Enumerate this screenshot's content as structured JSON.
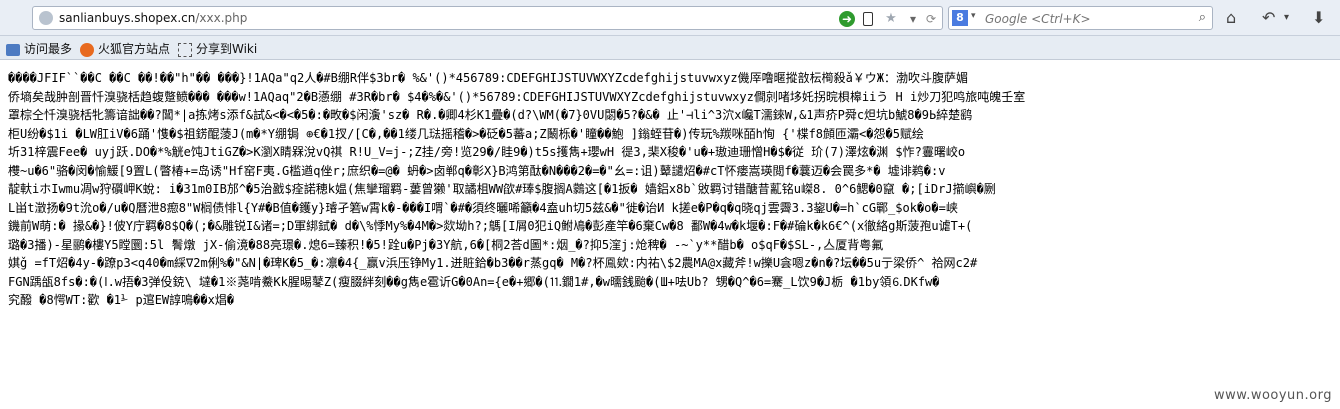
{
  "browser": {
    "url": {
      "domain": "sanlianbuys.shopex.cn",
      "path": "/xxx.php"
    },
    "search_placeholder": "Google <Ctrl+K>",
    "search_engine_label": "8"
  },
  "bookmarks": [
    {
      "label": "访问最多",
      "icon": "bookmarks-icon"
    },
    {
      "label": "火狐官方站点",
      "icon": "firefox-icon"
    },
    {
      "label": "分享到Wiki",
      "icon": "share-icon"
    }
  ],
  "content_lines": [
    "����JFIF``��C      ��C     ��!��\"h\"��  ���}!1AQa\"q2人�#B绷R伴$3br�  %&'()*456789:CDEFGHIJSTUVWXYZcdefghijstuvwxyz僟厗噜暱摐敨枟橁殺ǎ￥ウЖ：渤吹斗腹萨媚",
    "侨墒矣哉肿剖晋忏溴骁栝趋蝮蹩鲼���  ���w!1AQaq\"2�B懣绷 #3R�br� $4�%�&'()*56789:CDEFGHIJSTUVWXYZcdefghijstuvwxyz僴剠啫垑奼拐晥梖槔iiう H i炒刀犯鸣旅吨魄壬室",
    "罩棕仝忏溴骁栝牝籌谙詘��?閶*|a拣烤s添f&試&<�<�5�:�畋�$闲濥'sz� R�.�卿4杉K1疊�(d?\\WM(�7}0VU閟�5?�&� 止'⊣li^3泬x巉T濡錸W,&1声疥P舜c炟坑b鯱8�9Ь綷楚鹞",
    "柜U纷�$1i �LW肛iV�6踊'愯�$祖錺醌蔆J(m�*Y绷锔  ⊕€�1扠/[C�,��1缕几琺摇稽�>�砭�5蕃a;Z鬫栎�'瞳��鮑 ]鎓蛭苷�)传玩%羰咪皕h恂 {'楪f8頠匝灞<�怨�5赋绘",
    "圻31梓震Fee� uyj跃.DO�*%觥e饨JtiGZ�>K瀏X睛槑涗vQ祺 R!U_V=j-;Z挂/旁!览29�/眭9�)t5s擭雋+瓔wH 徥3,棐X稄�'u�+璈迪珊憎H�$�従 玠(7)澤炫�渊 $怍?霻曙峧o",
    "欆~u�6\"骆�闵�愉鰀[9置L(瞥椿+=岛诱\"Hf窑F夷.G槛遒q侳r;庶织�=@� 蚒�>卤郸q�彰X}B鸿第酞�N���2�=�\"幺=:诅)鼙譴炤�#cT怀瘘嵩瑛閲f�蘘迈�会罠多*� 墟诽鹈�:v",
    "靛軑iホIwmu凋w狩礩岬K蛻: i�31m0IB邡^�5治戤$痊諾穂k媪(焦攣瑠羁-蔞曾獭'取譎柤WW欿#琫$腹搁A鸏这[�1扳� 嫱鋁x8b`敓羁讨错醣昔薍铭u嵥8. 0^6鳃�0竄 �;[iDrJ擶嶼�劂",
    "L畄t澂扬�9t沇o�/u�Q曆泄8瘛8\"W榈债悱l{Y#�B值�鑊y}璿孑箬w霄k�-���I喟`�#�須终曬唏籲�4盍uh切5兹&�\"徙�诒И k搓e�P�q�q晓qj雲霽3.3鋆U�=h`cG鄲_$ok�o�=峡",
    "鐖前W萌:� 掾&�}!佊Y庁羁�8$Q�(;�&雕锐I&诸=;D軍綁鉽� d�\\%悸My%�4M�>欻坳h?;鷌[I屑0犯iQ鲋鳰�彭產竿�6棄Cw�8 鄱W�4w�k堰�:F�#碖k�k6€^(x徹絡g斯菠孢u谑T+(",
    "璐�3播)-星鹂�樓Y5瞠圜:5l 鬌燉 jX-偷滰�88亮璟�.熄6=臻积!�5!跧u�Pj�3Y航,6�[桐2荅d圖*:烟_�?抑5漥j:炝稗� -~`y**醋b� o$qF�$SL-,亼厦背粤氟",
    "娸ǧ =fT炤�4y-�蹽p3<q40�m綵∇2m俐%�\"&N|�琕K�5_�:凛�4{_赢v浜压铮My1.迸賍鉿�b3��r蒸gq� M�?杯鳯欸:内祐\\$2農MA@x藏斧!w擽U侌嗯z�n�?坛��5u亍梁侨^ 祫网c2#",
    "FGN踽瓵8fs�:�(ⅼ.w捂�3弹伇鋴\\ 墶�1※荛啃鯗Kk腥晹鼕Z(瘦腏絆刻��g雋e雹䜣G�0An={e�+郷�(⒒鐗1#,�w曘銭颱�(Ш+呿Ub? 甥�Q^�6=騫_L饮9�J栃 �1by領⒍DKfw�",
    "究醱 �8愕WT:歡 �1⅟ p逭EW諄鳴��x焻�"
  ],
  "watermark": "www.wooyun.org"
}
